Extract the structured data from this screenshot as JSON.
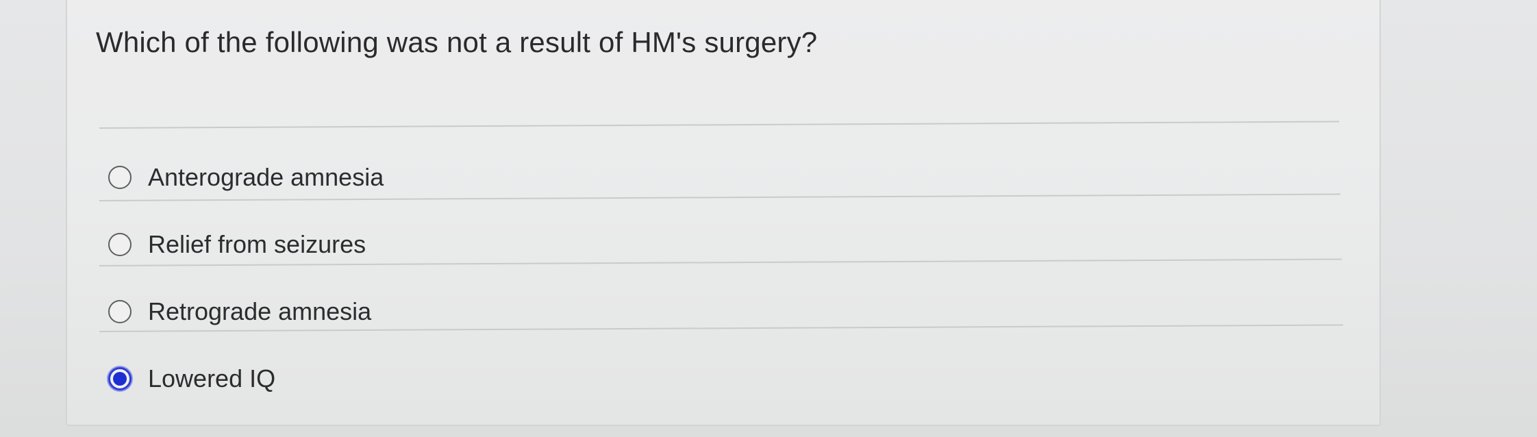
{
  "question": {
    "text": "Which of the following was not a result of HM's surgery?"
  },
  "options": [
    {
      "label": "Anterograde amnesia",
      "selected": false
    },
    {
      "label": "Relief from seizures",
      "selected": false
    },
    {
      "label": "Retrograde amnesia",
      "selected": false
    },
    {
      "label": "Lowered IQ",
      "selected": true
    }
  ],
  "colors": {
    "selected_radio": "#1d2fd0",
    "text": "#2c2c2e",
    "background": "#e6e7e8"
  }
}
